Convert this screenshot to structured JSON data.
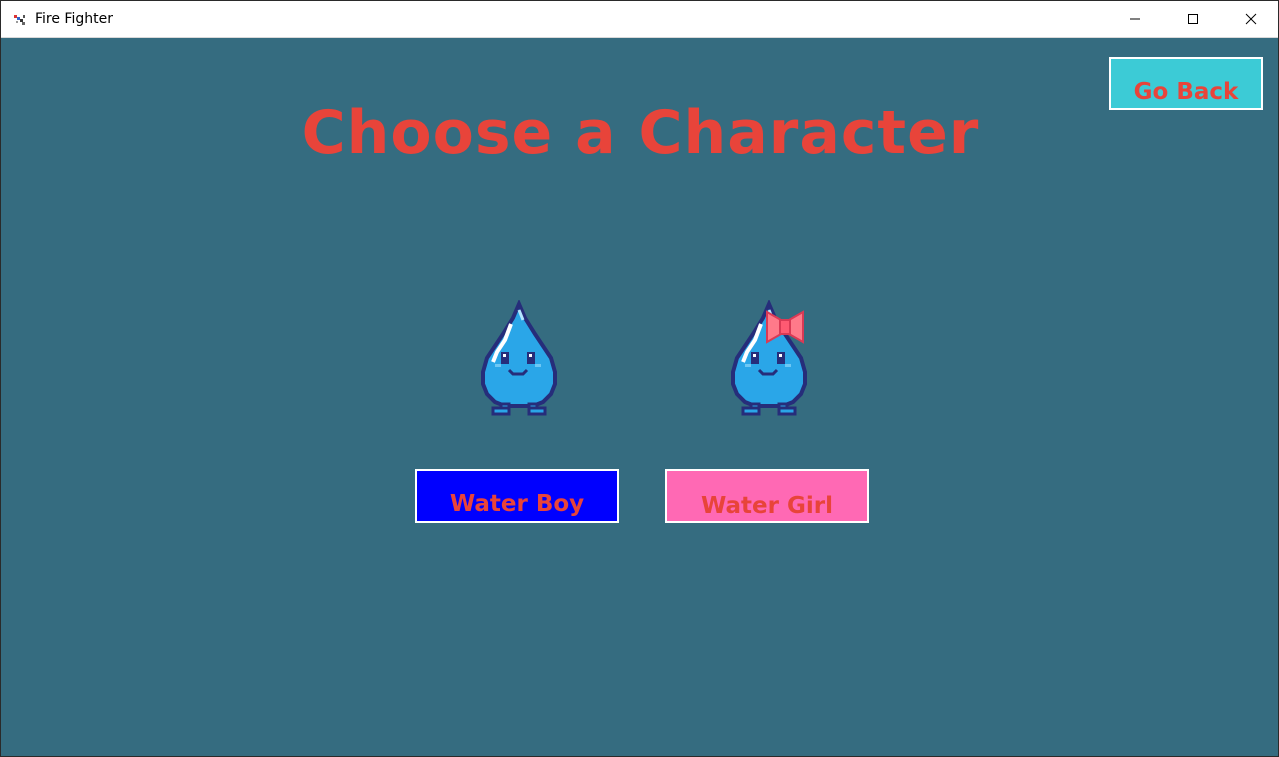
{
  "window": {
    "title": "Fire Fighter",
    "app_icon": "firefighter-app-icon",
    "controls": {
      "minimize_icon": "minimize-icon",
      "maximize_icon": "maximize-icon",
      "close_icon": "close-icon"
    }
  },
  "screen": {
    "heading": "Choose a Character",
    "go_back_label": "Go Back",
    "characters": [
      {
        "label": "Water Boy",
        "sprite_icon": "water-drop-character-icon",
        "button_color": "#0000ff"
      },
      {
        "label": "Water Girl",
        "sprite_icon": "water-drop-character-with-bow-icon",
        "button_color": "#ff69b4"
      }
    ]
  },
  "colors": {
    "background": "#356c80",
    "text_accent": "#e8443a",
    "go_back_fill": "#3ccbd6",
    "button_border": "#ffffff"
  }
}
